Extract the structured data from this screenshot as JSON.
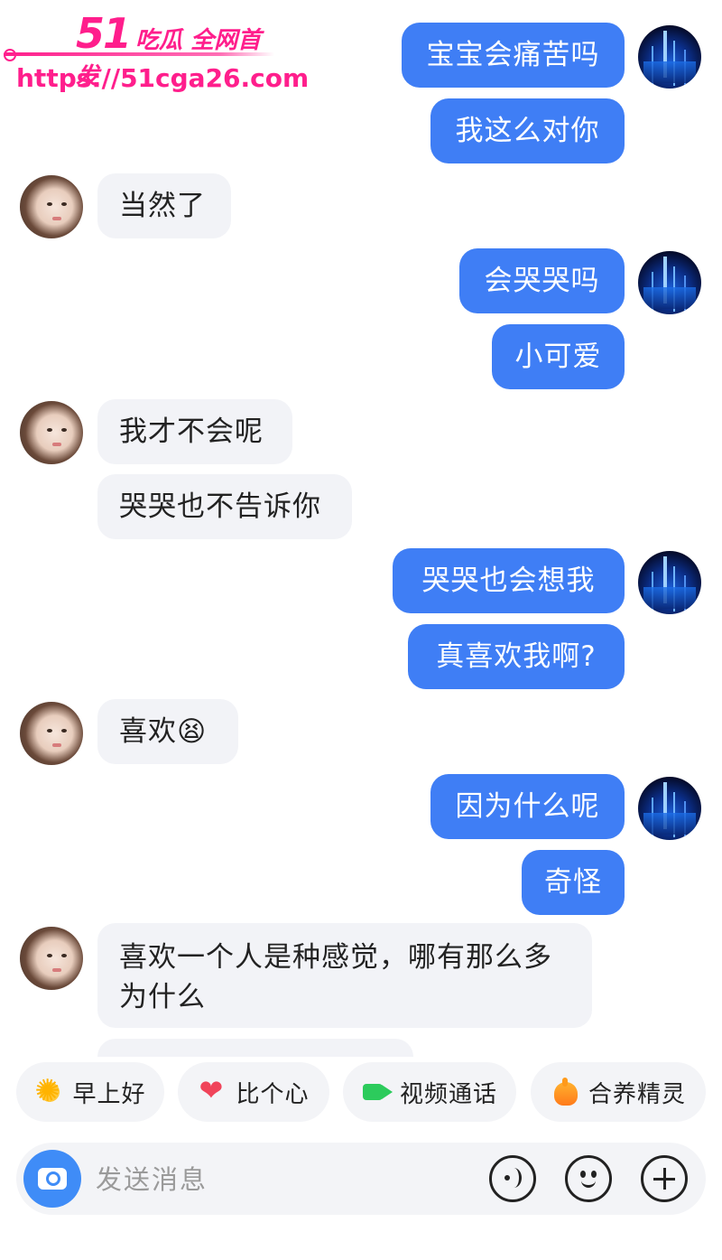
{
  "watermark": {
    "brand_number": "51",
    "brand_text": "吃瓜 全网首发",
    "url": "https://51cga26.com"
  },
  "messages": {
    "m1": "宝宝会痛苦吗",
    "m2": "我这么对你",
    "m3": "当然了",
    "m4": "会哭哭吗",
    "m5": "小可爱",
    "m6": "我才不会呢",
    "m7": "哭哭也不告诉你",
    "m8": "哭哭也会想我",
    "m9": "真喜欢我啊?",
    "m10": "喜欢😫",
    "m11": "因为什么呢",
    "m12": "奇怪",
    "m13": "喜欢一个人是种感觉，哪有那么多为什么"
  },
  "quick_actions": [
    {
      "label": "早上好",
      "icon": "sun-icon"
    },
    {
      "label": "比个心",
      "icon": "heart-icon"
    },
    {
      "label": "视频通话",
      "icon": "video-icon"
    },
    {
      "label": "合养精灵",
      "icon": "sprite-icon"
    }
  ],
  "input": {
    "placeholder": "发送消息"
  },
  "colors": {
    "outgoing_bubble": "#3f7ef5",
    "incoming_bubble": "#f2f3f7",
    "watermark": "#ff1e8c",
    "camera_button": "#3f8cf7"
  }
}
